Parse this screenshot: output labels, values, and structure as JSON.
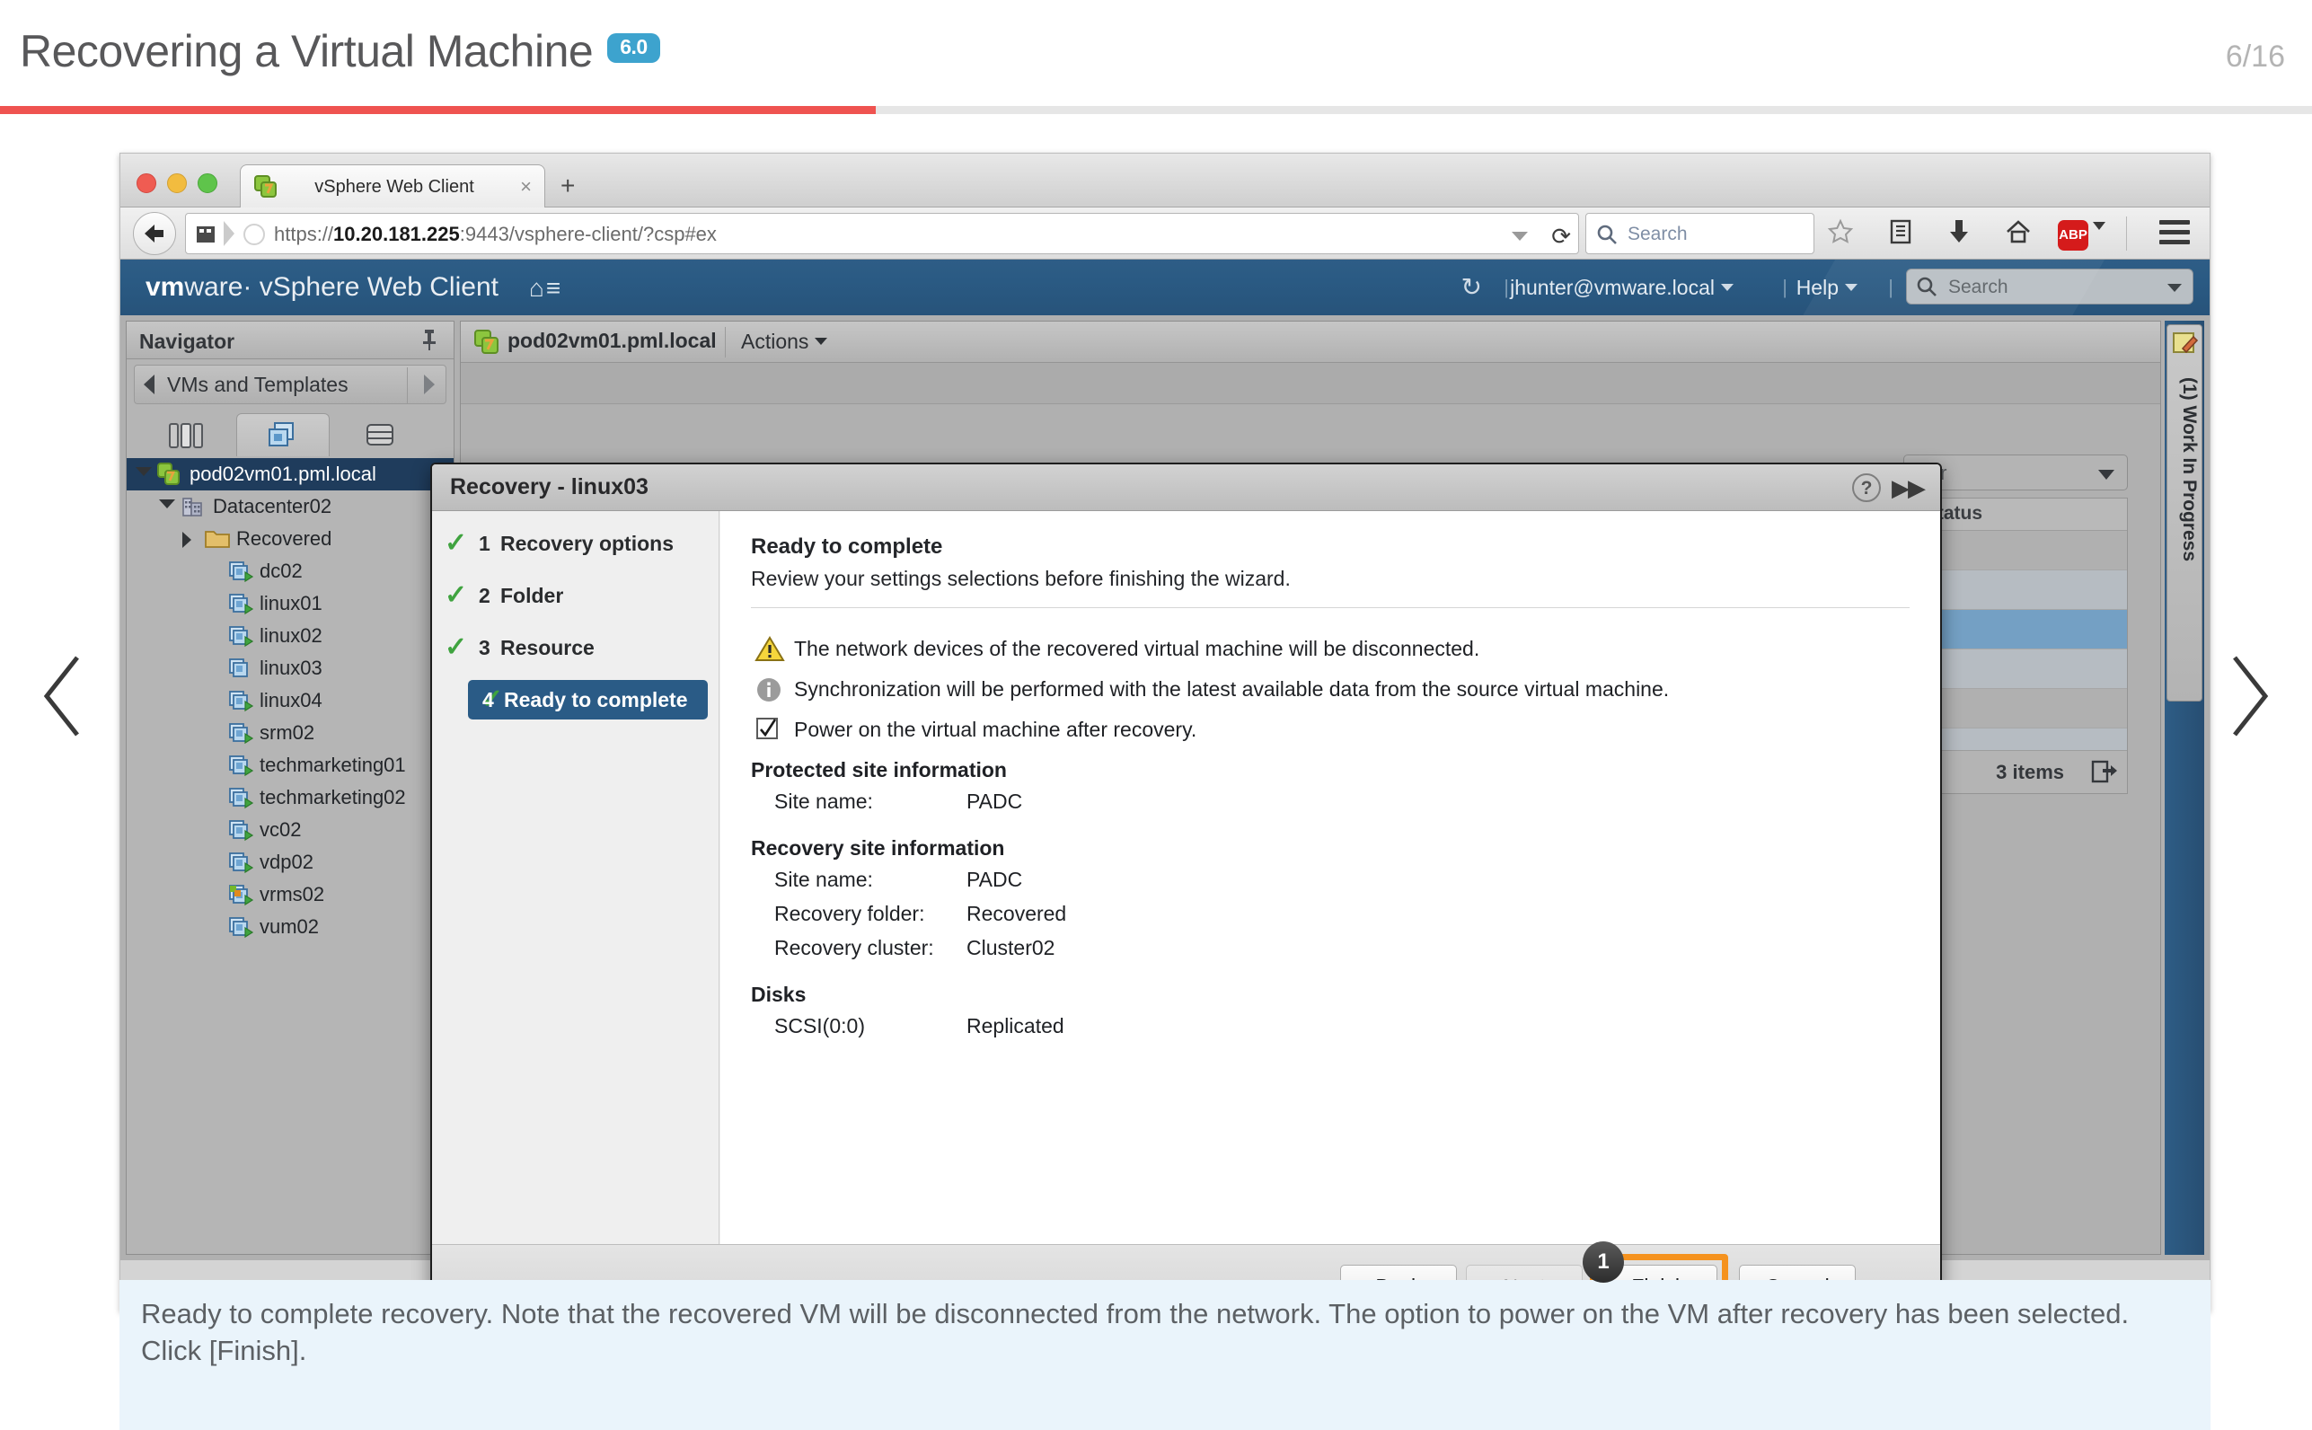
{
  "slide": {
    "title": "Recovering a Virtual Machine",
    "version_badge": "6.0",
    "page_counter": "6/16",
    "accent_color": "#ef5350",
    "badge_color": "#3da3ce",
    "prev_label": "previous-slide",
    "next_label": "next-slide"
  },
  "caption": {
    "text": "Ready to complete recovery. Note that the recovered VM will be disconnected from the network. The option to power on the VM after recovery has been selected. Click [Finish]."
  },
  "browser": {
    "tab_title": "vSphere Web Client",
    "tab_close": "×",
    "new_tab": "+",
    "url_prefix": "https://",
    "url_host": "10.20.181.225",
    "url_suffix": ":9443/vsphere-client/?csp#ex",
    "reload_glyph": "⟳",
    "search_placeholder": "Search",
    "abp_label": "ABP"
  },
  "vsphere": {
    "brand_bold": "vm",
    "brand_rest": "ware·",
    "product": "vSphere Web Client",
    "refresh_glyph": "↻",
    "user": "jhunter@vmware.local",
    "help": "Help",
    "search_placeholder": "Search",
    "separator": "|"
  },
  "navigator": {
    "title": "Navigator",
    "pin_glyph": "✐",
    "breadcrumb": "VMs and Templates",
    "tabs": [
      {
        "name": "hosts-and-clusters",
        "active": false
      },
      {
        "name": "vms-and-templates",
        "active": true
      },
      {
        "name": "storage",
        "active": false
      }
    ],
    "tree": [
      {
        "label": "pod02vm01.pml.local",
        "depth": 0,
        "twisty": "open",
        "icon": "vcenter",
        "selected": true
      },
      {
        "label": "Datacenter02",
        "depth": 1,
        "twisty": "open",
        "icon": "datacenter",
        "selected": false
      },
      {
        "label": "Recovered",
        "depth": 2,
        "twisty": "closed",
        "icon": "folder",
        "selected": false
      },
      {
        "label": "dc02",
        "depth": 3,
        "twisty": "none",
        "icon": "vm",
        "selected": false
      },
      {
        "label": "linux01",
        "depth": 3,
        "twisty": "none",
        "icon": "vm",
        "selected": false
      },
      {
        "label": "linux02",
        "depth": 3,
        "twisty": "none",
        "icon": "vm",
        "selected": false
      },
      {
        "label": "linux03",
        "depth": 3,
        "twisty": "none",
        "icon": "vm-off",
        "selected": false
      },
      {
        "label": "linux04",
        "depth": 3,
        "twisty": "none",
        "icon": "vm",
        "selected": false
      },
      {
        "label": "srm02",
        "depth": 3,
        "twisty": "none",
        "icon": "vm",
        "selected": false
      },
      {
        "label": "techmarketing01",
        "depth": 3,
        "twisty": "none",
        "icon": "vm",
        "selected": false
      },
      {
        "label": "techmarketing02",
        "depth": 3,
        "twisty": "none",
        "icon": "vm",
        "selected": false
      },
      {
        "label": "vc02",
        "depth": 3,
        "twisty": "none",
        "icon": "vm",
        "selected": false
      },
      {
        "label": "vdp02",
        "depth": 3,
        "twisty": "none",
        "icon": "vm",
        "selected": false
      },
      {
        "label": "vrms02",
        "depth": 3,
        "twisty": "none",
        "icon": "vm-alert",
        "selected": false
      },
      {
        "label": "vum02",
        "depth": 3,
        "twisty": "none",
        "icon": "vm",
        "selected": false
      }
    ]
  },
  "content": {
    "object_name": "pod02vm01.pml.local",
    "actions_label": "Actions",
    "filter_label": "ilter",
    "column_header": "t Status",
    "item_count": "3 items"
  },
  "right_rail": {
    "work_in_progress": "(1) Work In Progress"
  },
  "dialog": {
    "title": "Recovery - linux03",
    "help_glyph": "?",
    "expand_glyph": "▶▶",
    "steps": [
      {
        "num": "1",
        "label": "Recovery options",
        "done": true,
        "current": false
      },
      {
        "num": "2",
        "label": "Folder",
        "done": true,
        "current": false
      },
      {
        "num": "3",
        "label": "Resource",
        "done": true,
        "current": false
      },
      {
        "num": "4",
        "label": "Ready to complete",
        "done": true,
        "current": true
      }
    ],
    "heading": "Ready to complete",
    "subheading": "Review your settings selections before finishing the wizard.",
    "notices": [
      {
        "icon": "warning-icon",
        "text": "The network devices of the recovered virtual machine will be disconnected."
      },
      {
        "icon": "info-icon",
        "text": "Synchronization will be performed with the latest available data from the source virtual machine."
      },
      {
        "icon": "checkbox-checked-icon",
        "text": "Power on the virtual machine after recovery."
      }
    ],
    "sections": [
      {
        "heading": "Protected site information",
        "rows": [
          {
            "key": "Site name:",
            "value": "PADC"
          }
        ]
      },
      {
        "heading": "Recovery site information",
        "rows": [
          {
            "key": "Site name:",
            "value": "PADC"
          },
          {
            "key": "Recovery folder:",
            "value": "Recovered"
          },
          {
            "key": "Recovery cluster:",
            "value": "Cluster02"
          }
        ]
      },
      {
        "heading": "Disks",
        "rows": [
          {
            "key": "SCSI(0:0)",
            "value": "Replicated"
          }
        ]
      }
    ],
    "buttons": {
      "back": "Back",
      "next": "Next",
      "finish": "Finish",
      "cancel": "Cancel"
    },
    "callout_number": "1",
    "highlight_color": "#f5921e"
  }
}
